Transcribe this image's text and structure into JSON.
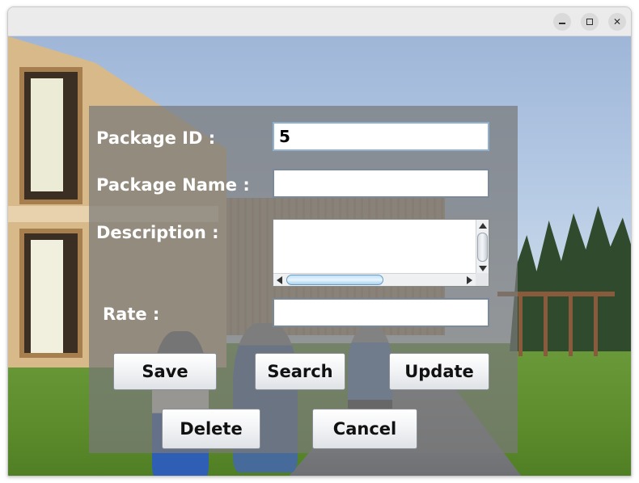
{
  "window": {
    "controls": {
      "minimize_icon": "minimize-icon",
      "maximize_icon": "maximize-icon",
      "close_icon": "close-icon",
      "close_glyph": "✕"
    }
  },
  "form": {
    "package_id": {
      "label": "Package ID :",
      "value": "5"
    },
    "package_name": {
      "label": "Package Name :",
      "value": ""
    },
    "description": {
      "label": "Description :",
      "value": ""
    },
    "rate": {
      "label": "Rate :",
      "value": ""
    }
  },
  "buttons": {
    "save": "Save",
    "search": "Search",
    "update": "Update",
    "delete": "Delete",
    "cancel": "Cancel"
  },
  "colors": {
    "panel_overlay": "#787878",
    "label_text": "#ffffff",
    "button_face": "#f3f4f6",
    "scroll_thumb_accent": "#bfe0f6"
  }
}
